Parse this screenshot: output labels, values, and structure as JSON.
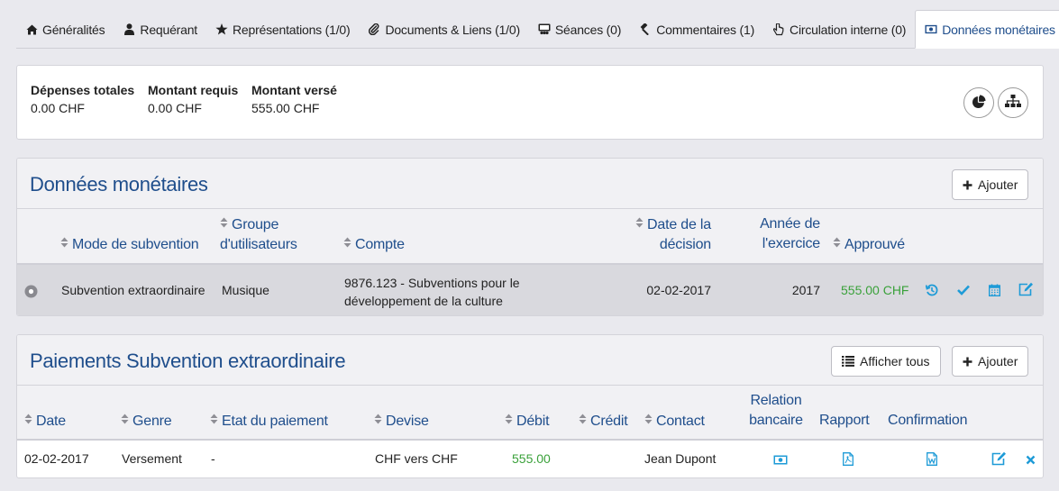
{
  "tabs": [
    {
      "label": "Généralités",
      "icon": "home-icon"
    },
    {
      "label": "Requérant",
      "icon": "user-icon"
    },
    {
      "label": "Représentations (1/0)",
      "icon": "star-icon"
    },
    {
      "label": "Documents & Liens (1/0)",
      "icon": "paperclip-icon"
    },
    {
      "label": "Séances (0)",
      "icon": "meeting-icon"
    },
    {
      "label": "Commentaires (1)",
      "icon": "gavel-icon"
    },
    {
      "label": "Circulation interne (0)",
      "icon": "hand-pointer-icon"
    },
    {
      "label": "Données monétaires",
      "icon": "money-icon"
    }
  ],
  "summary": {
    "total_label": "Dépenses totales",
    "total_value": "0.00 CHF",
    "requested_label": "Montant requis",
    "requested_value": "0.00 CHF",
    "paid_label": "Montant versé",
    "paid_value": "555.00 CHF"
  },
  "monetary": {
    "title": "Données monétaires",
    "add_label": "Ajouter",
    "headers": {
      "mode": "Mode de subvention",
      "group_1": "Groupe",
      "group_2": "d'utilisateurs",
      "account": "Compte",
      "decision_1": "Date de la",
      "decision_2": "décision",
      "year_1": "Année de",
      "year_2": "l'exercice",
      "approved": "Approuvé"
    },
    "row": {
      "mode": "Subvention extraordinaire",
      "group": "Musique",
      "account_1": "9876.123 - Subventions pour le",
      "account_2": "développement de la culture",
      "decision": "02-02-2017",
      "year": "2017",
      "approved": "555.00 CHF"
    }
  },
  "payments": {
    "title": "Paiements Subvention extraordinaire",
    "show_all_label": "Afficher tous",
    "add_label": "Ajouter",
    "headers": {
      "date": "Date",
      "genre": "Genre",
      "status": "Etat du paiement",
      "currency": "Devise",
      "debit": "Débit",
      "credit": "Crédit",
      "contact": "Contact",
      "bank_1": "Relation",
      "bank_2": "bancaire",
      "report": "Rapport",
      "confirmation": "Confirmation"
    },
    "row": {
      "date": "02-02-2017",
      "genre": "Versement",
      "status": "-",
      "currency": "CHF vers CHF",
      "debit": "555.00",
      "credit": "",
      "contact": "Jean Dupont"
    }
  },
  "colors": {
    "accent": "#1f4e8c",
    "icon_blue": "#1e9bd7",
    "positive": "#3aa13a"
  }
}
